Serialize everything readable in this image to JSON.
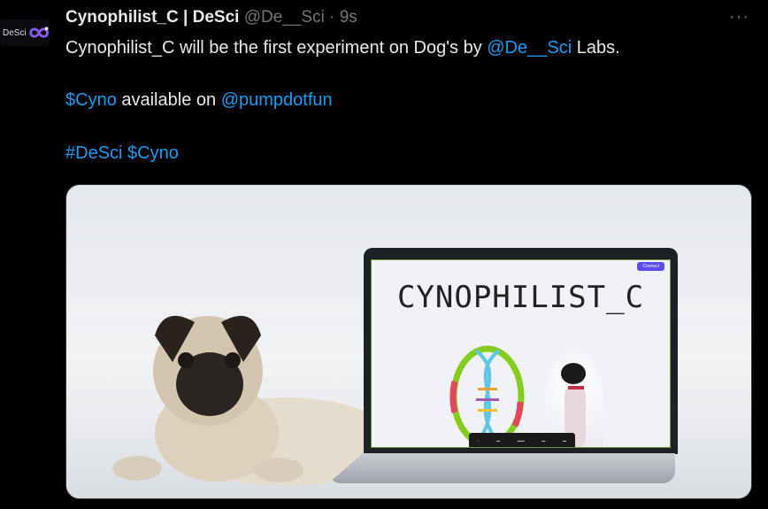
{
  "avatar": {
    "text": "DeSci"
  },
  "tweet": {
    "name": "Cynophilist_C | DeSci",
    "handle": "@De__Sci",
    "separator": "·",
    "time": "9s",
    "line1_pre": "Cynophilist_C will be the first experiment on Dog's by ",
    "line1_link": "@De__Sci",
    "line1_post": " Labs.",
    "line2_cashtag": "$Cyno",
    "line2_mid": " available on ",
    "line2_link": "@pumpdotfun",
    "line3_hashtag": "#DeSci",
    "line3_cashtag": "$Cyno"
  },
  "more_label": "···",
  "media": {
    "screen_title": "CYNOPHILIST_C",
    "screen_button": "Connect"
  },
  "colors": {
    "link": "#1d9bf0",
    "bg": "#000000",
    "text": "#e7e9ea",
    "muted": "#71767b"
  }
}
